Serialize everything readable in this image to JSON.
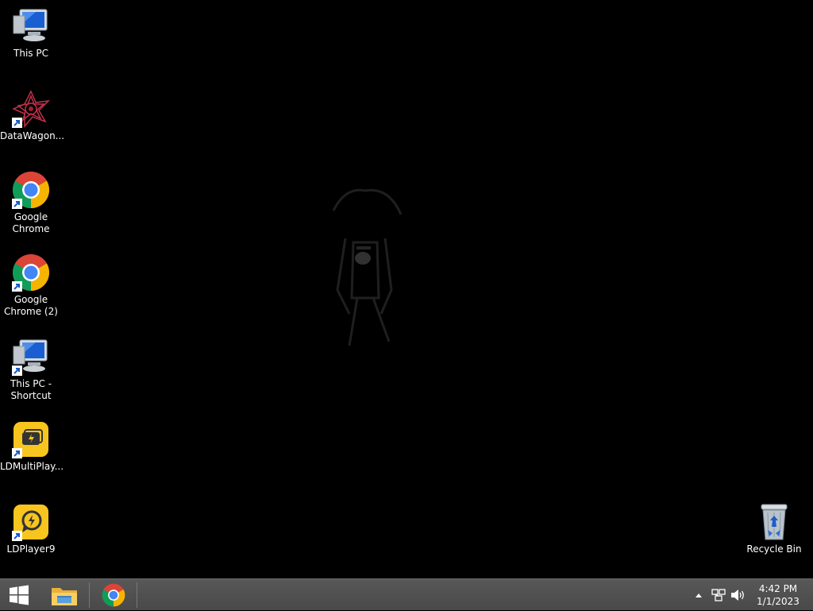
{
  "desktop": {
    "icons": [
      {
        "label": "This PC",
        "icon": "this-pc-icon"
      },
      {
        "label": "DataWagon...",
        "icon": "datawagon-icon"
      },
      {
        "label": "Google\nChrome",
        "icon": "chrome-icon"
      },
      {
        "label": "Google\nChrome (2)",
        "icon": "chrome-icon"
      },
      {
        "label": "This PC -\nShortcut",
        "icon": "this-pc-icon"
      },
      {
        "label": "LDMultiPlay...",
        "icon": "ldmultiplayer-icon"
      },
      {
        "label": "LDPlayer9",
        "icon": "ldplayer-icon"
      }
    ],
    "recycle_bin": {
      "label": "Recycle Bin",
      "icon": "recycle-bin-icon"
    }
  },
  "taskbar": {
    "start_icon": "windows-start-icon",
    "pinned": [
      "file-explorer-icon",
      "chrome-icon"
    ],
    "tray": {
      "icons": [
        "show-hidden-icons-arrow",
        "network-icon",
        "volume-icon"
      ],
      "time": "4:42 PM",
      "date": "1/1/2023"
    }
  },
  "colors": {
    "taskbar": "#4f4f4f",
    "desktop_bg": "#000000",
    "ld_yellow": "#f7c51e"
  }
}
